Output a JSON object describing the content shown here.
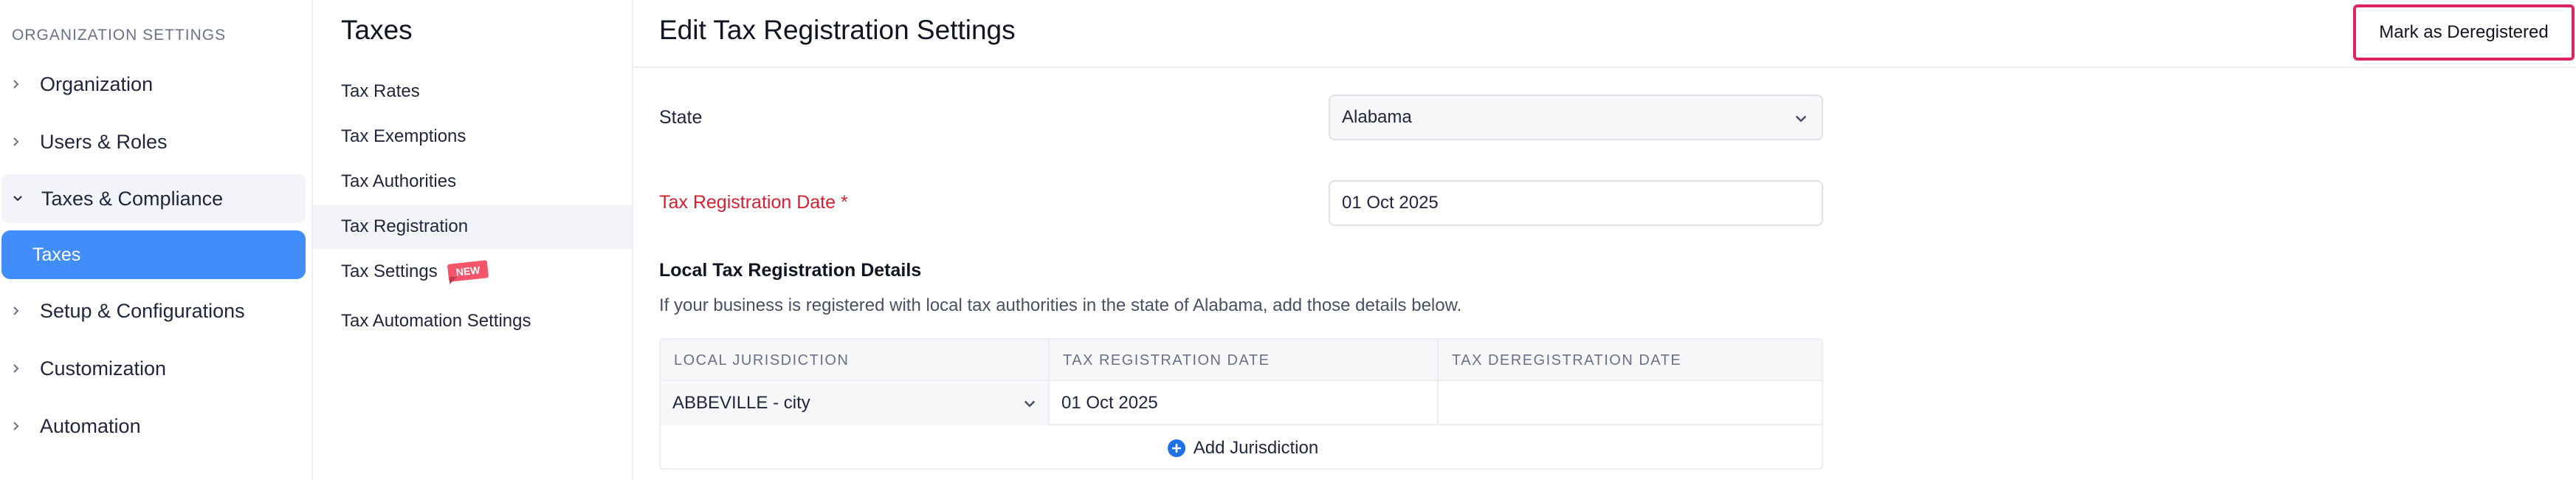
{
  "sidebar": {
    "heading": "ORGANIZATION SETTINGS",
    "items": [
      {
        "label": "Organization",
        "expanded": false
      },
      {
        "label": "Users & Roles",
        "expanded": false
      },
      {
        "label": "Taxes & Compliance",
        "expanded": true
      },
      {
        "label": "Setup & Configurations",
        "expanded": false
      },
      {
        "label": "Customization",
        "expanded": false
      },
      {
        "label": "Automation",
        "expanded": false
      }
    ],
    "active_subitem": "Taxes"
  },
  "taxes_nav": {
    "title": "Taxes",
    "items": [
      {
        "label": "Tax Rates"
      },
      {
        "label": "Tax Exemptions"
      },
      {
        "label": "Tax Authorities"
      },
      {
        "label": "Tax Registration",
        "active": true
      },
      {
        "label": "Tax Settings",
        "badge": "NEW"
      },
      {
        "label": "Tax Automation Settings"
      }
    ]
  },
  "main": {
    "title": "Edit Tax Registration Settings",
    "deregister_button": "Mark as Deregistered",
    "state_label": "State",
    "state_value": "Alabama",
    "registration_date_label": "Tax Registration Date *",
    "registration_date_value": "01 Oct 2025",
    "local_section_title": "Local Tax Registration Details",
    "local_section_desc": "If your business is registered with local tax authorities in the state of Alabama, add those details below.",
    "jurisdiction_table": {
      "columns": [
        "LOCAL JURISDICTION",
        "TAX REGISTRATION DATE",
        "TAX DEREGISTRATION DATE"
      ],
      "rows": [
        {
          "jurisdiction": "ABBEVILLE - city",
          "registration_date": "01 Oct 2025",
          "deregistration_date": ""
        }
      ],
      "add_label": "Add Jurisdiction"
    }
  },
  "colors": {
    "accent_blue": "#408dfb",
    "required_red": "#d6202f",
    "highlight_border": "#e0245e",
    "new_badge": "#f4556a"
  }
}
